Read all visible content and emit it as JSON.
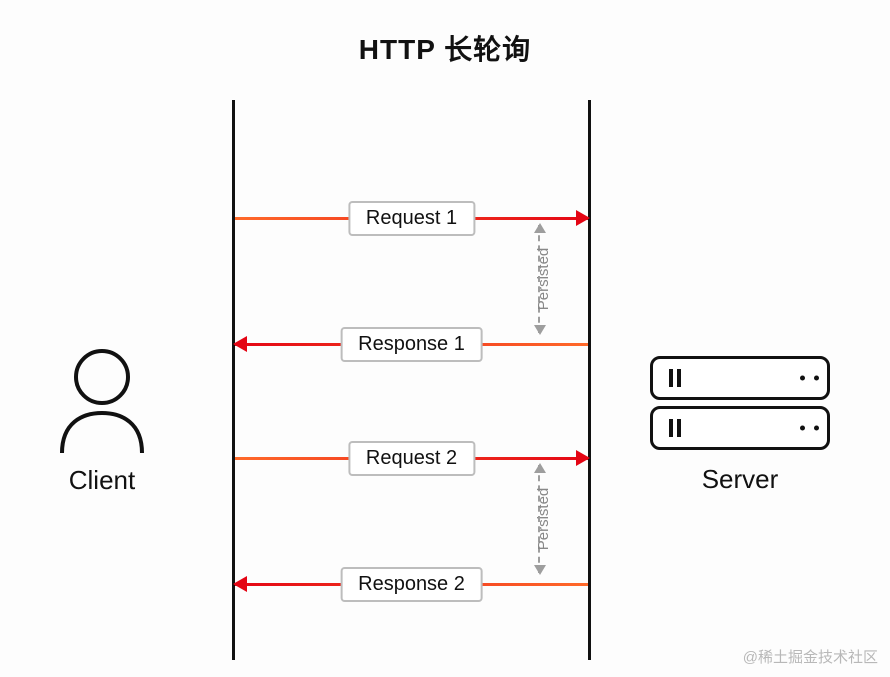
{
  "title": "HTTP 长轮询",
  "client_label": "Client",
  "server_label": "Server",
  "arrows": {
    "req1": "Request 1",
    "res1": "Response 1",
    "req2": "Request 2",
    "res2": "Response 2"
  },
  "persisted_label": "Persisted",
  "watermark": "@稀土掘金技术社区"
}
